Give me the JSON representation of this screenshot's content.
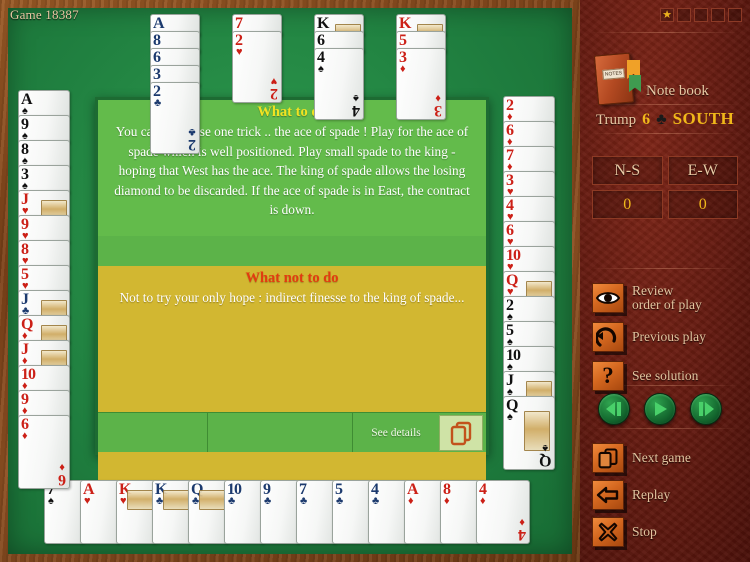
{
  "panel": {
    "game_label": "Game 18387",
    "stars_total": 5,
    "stars_filled": 1,
    "star_glyph": "★",
    "notebook_label": "Note book",
    "notebook_cover_text": "NOTES",
    "trump_word": "Trump",
    "trump_level": "6",
    "trump_suit": "♣",
    "declarer": "SOUTH",
    "score": {
      "headers": [
        "N-S",
        "E-W"
      ],
      "values": [
        "0",
        "0"
      ]
    },
    "commands": [
      {
        "icon": "eye-icon",
        "label": "Review\norder of play",
        "line1": "Review",
        "line2": "order of play"
      },
      {
        "icon": "undo-arrow-icon",
        "label": "Previous play",
        "line1": "Previous play",
        "line2": ""
      },
      {
        "icon": "question-mark-icon",
        "label": "See solution",
        "line1": "See solution",
        "line2": ""
      }
    ],
    "nav_buttons": [
      {
        "icon": "skip-previous-icon"
      },
      {
        "icon": "play-icon"
      },
      {
        "icon": "skip-next-icon"
      }
    ],
    "commands2": [
      {
        "icon": "cards-icon",
        "label": "Next game"
      },
      {
        "icon": "left-arrow-icon",
        "label": "Replay"
      },
      {
        "icon": "cross-icon",
        "label": "Stop"
      }
    ]
  },
  "dialog": {
    "good_title": "What to do",
    "good_text": "You can only lose one trick .. the ace of spade ! Play for the ace of spade which is well positioned. Play small spade to the king - hoping that West has the ace. The king of spade allows the losing diamond to be discarded.  If the ace of spade is in East, the contract is down.",
    "bad_title": "What not to do",
    "bad_text": "Not to try your only hope : indirect finesse to the king of spade...",
    "see_details": "See details"
  },
  "table": {
    "north": [
      {
        "suit": "clubs",
        "symbol": "♣",
        "color": "blu",
        "ranks": [
          "A",
          "8",
          "6",
          "3",
          "2"
        ]
      },
      {
        "suit": "hearts",
        "symbol": "♥",
        "color": "red",
        "ranks": [
          "7",
          "2"
        ]
      },
      {
        "suit": "spades",
        "symbol": "♠",
        "color": "blk",
        "ranks": [
          "K",
          "6",
          "4"
        ]
      },
      {
        "suit": "diamonds",
        "symbol": "♦",
        "color": "red",
        "ranks": [
          "K",
          "5",
          "3"
        ]
      }
    ],
    "west": [
      {
        "suit": "spades",
        "symbol": "♠",
        "color": "blk",
        "ranks": [
          "A",
          "9",
          "8",
          "3"
        ]
      },
      {
        "suit": "hearts",
        "symbol": "♥",
        "color": "red",
        "ranks": [
          "J",
          "9",
          "8",
          "5"
        ]
      },
      {
        "suit": "clubs",
        "symbol": "♣",
        "color": "blu",
        "ranks": [
          "J"
        ]
      },
      {
        "suit": "diamonds",
        "symbol": "♦",
        "color": "red",
        "ranks": [
          "Q",
          "J",
          "10",
          "9",
          "6"
        ]
      }
    ],
    "east": [
      {
        "suit": "diamonds",
        "symbol": "♦",
        "color": "red",
        "ranks": [
          "2",
          "6",
          "7"
        ]
      },
      {
        "suit": "hearts",
        "symbol": "♥",
        "color": "red",
        "ranks": [
          "3",
          "4",
          "6",
          "10",
          "Q"
        ]
      },
      {
        "suit": "spades",
        "symbol": "♠",
        "color": "blk",
        "ranks": [
          "2",
          "5",
          "10",
          "J",
          "Q"
        ]
      }
    ],
    "south": [
      {
        "rank": "7",
        "symbol": "♠",
        "color": "blk",
        "face": false
      },
      {
        "rank": "A",
        "symbol": "♥",
        "color": "red",
        "face": false
      },
      {
        "rank": "K",
        "symbol": "♥",
        "color": "red",
        "face": true
      },
      {
        "rank": "K",
        "symbol": "♣",
        "color": "blu",
        "face": true
      },
      {
        "rank": "Q",
        "symbol": "♣",
        "color": "blu",
        "face": true
      },
      {
        "rank": "10",
        "symbol": "♣",
        "color": "blu",
        "face": false
      },
      {
        "rank": "9",
        "symbol": "♣",
        "color": "blu",
        "face": false
      },
      {
        "rank": "7",
        "symbol": "♣",
        "color": "blu",
        "face": false
      },
      {
        "rank": "5",
        "symbol": "♣",
        "color": "blu",
        "face": false
      },
      {
        "rank": "4",
        "symbol": "♣",
        "color": "blu",
        "face": false
      },
      {
        "rank": "A",
        "symbol": "♦",
        "color": "red",
        "face": false
      },
      {
        "rank": "8",
        "symbol": "♦",
        "color": "red",
        "face": false
      },
      {
        "rank": "4",
        "symbol": "♦",
        "color": "red",
        "face": false
      }
    ]
  },
  "colors": {
    "felt_green": "#208040",
    "wood_brown": "#7d4219",
    "leather_red": "#631a10",
    "gold": "#f0b81a",
    "dialog_green": "#63bb4b",
    "dialog_gold": "#d2b731",
    "card_red": "#cc2017",
    "card_blue": "#1c3a6e"
  }
}
